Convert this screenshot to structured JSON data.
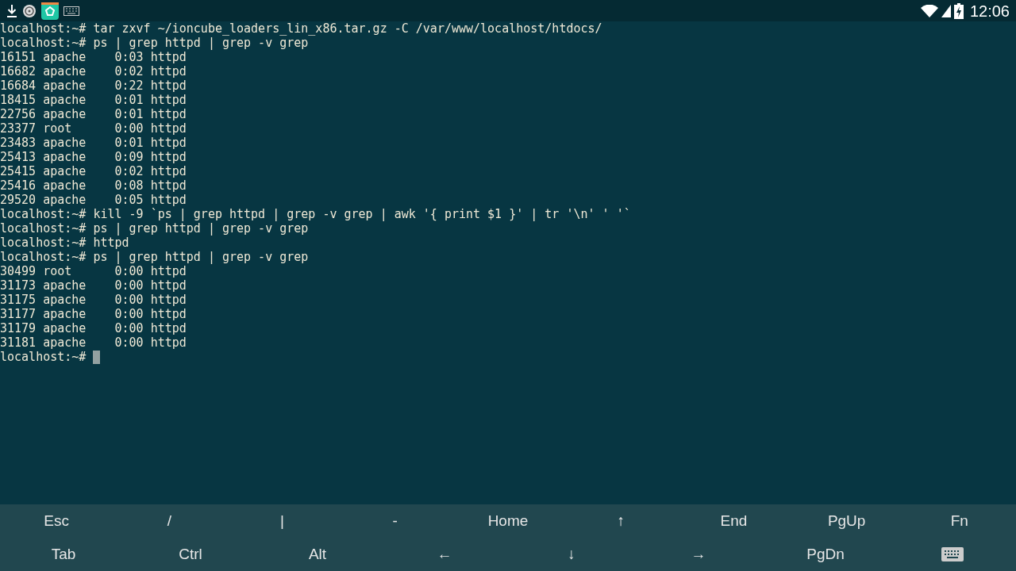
{
  "status_bar": {
    "time": "12:06"
  },
  "terminal": {
    "lines": [
      "localhost:~# tar zxvf ~/ioncube_loaders_lin_x86.tar.gz -C /var/www/localhost/htdocs/",
      "localhost:~# ps | grep httpd | grep -v grep",
      "16151 apache    0:03 httpd",
      "16682 apache    0:02 httpd",
      "16684 apache    0:22 httpd",
      "18415 apache    0:01 httpd",
      "22756 apache    0:01 httpd",
      "23377 root      0:00 httpd",
      "23483 apache    0:01 httpd",
      "25413 apache    0:09 httpd",
      "25415 apache    0:02 httpd",
      "25416 apache    0:08 httpd",
      "29520 apache    0:05 httpd",
      "localhost:~# kill -9 `ps | grep httpd | grep -v grep | awk '{ print $1 }' | tr '\\n' ' '`",
      "localhost:~# ps | grep httpd | grep -v grep",
      "localhost:~# httpd",
      "localhost:~# ps | grep httpd | grep -v grep",
      "30499 root      0:00 httpd",
      "31173 apache    0:00 httpd",
      "31175 apache    0:00 httpd",
      "31177 apache    0:00 httpd",
      "31179 apache    0:00 httpd",
      "31181 apache    0:00 httpd"
    ],
    "prompt": "localhost:~#"
  },
  "extra_keys": [
    [
      {
        "kind": "text",
        "label": "Esc"
      },
      {
        "kind": "text",
        "label": "/"
      },
      {
        "kind": "text",
        "label": "|"
      },
      {
        "kind": "text",
        "label": "-"
      },
      {
        "kind": "text",
        "label": "Home"
      },
      {
        "kind": "text",
        "label": "↑"
      },
      {
        "kind": "text",
        "label": "End"
      },
      {
        "kind": "text",
        "label": "PgUp"
      },
      {
        "kind": "text",
        "label": "Fn"
      }
    ],
    [
      {
        "kind": "text",
        "label": "Tab"
      },
      {
        "kind": "text",
        "label": "Ctrl"
      },
      {
        "kind": "text",
        "label": "Alt"
      },
      {
        "kind": "text",
        "label": "←"
      },
      {
        "kind": "text",
        "label": "↓"
      },
      {
        "kind": "text",
        "label": "→"
      },
      {
        "kind": "text",
        "label": "PgDn"
      },
      {
        "kind": "keyboard"
      }
    ]
  ]
}
